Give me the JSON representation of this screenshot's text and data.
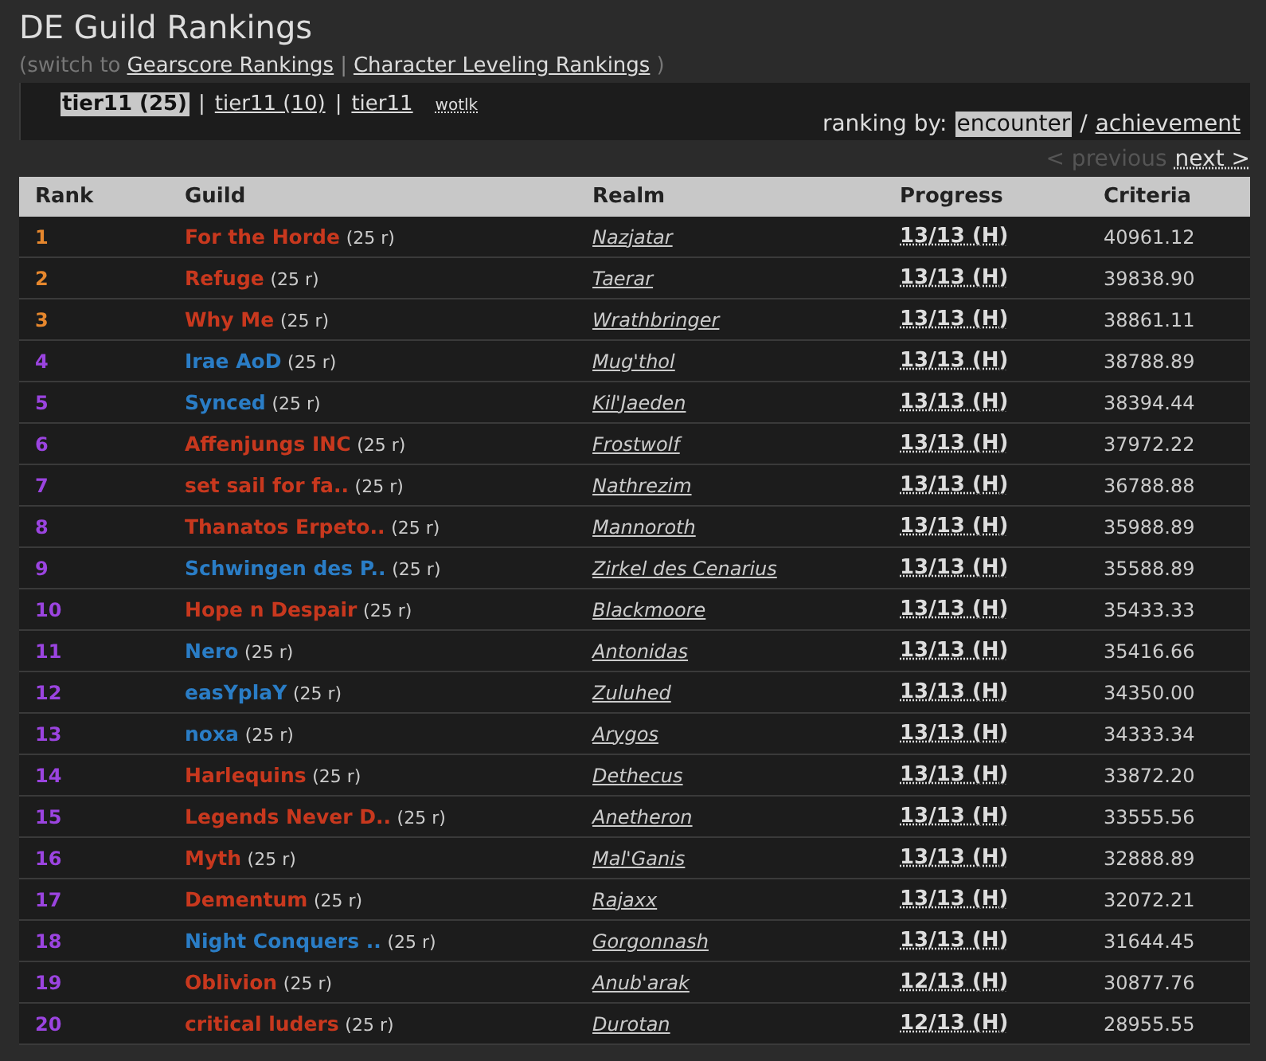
{
  "title": "DE Guild Rankings",
  "switch": {
    "prefix": "(switch to",
    "links": [
      "Gearscore Rankings",
      "Character Leveling Rankings"
    ],
    "separator": "|",
    "suffix": ")"
  },
  "tabs": [
    {
      "label": "tier11 (25)",
      "selected": true,
      "kind": "main"
    },
    {
      "label": "tier11 (10)",
      "selected": false,
      "kind": "main"
    },
    {
      "label": "tier11",
      "selected": false,
      "kind": "main"
    },
    {
      "label": "wotlk",
      "selected": false,
      "kind": "small"
    }
  ],
  "tab_separator": "|",
  "ranking_by": {
    "label": "ranking by:",
    "separator": "/",
    "options": [
      {
        "label": "encounter",
        "selected": true
      },
      {
        "label": "achievement",
        "selected": false
      }
    ]
  },
  "pager": {
    "previous": {
      "label": "< previous",
      "disabled": true
    },
    "next": {
      "label": "next >",
      "disabled": false
    }
  },
  "table": {
    "columns": [
      "Rank",
      "Guild",
      "Realm",
      "Progress",
      "Criteria"
    ],
    "rows": [
      {
        "rank": {
          "text": "1",
          "color": "#e6872d"
        },
        "guild": {
          "name": "For the Horde",
          "color": "#c8381e"
        },
        "size": "(25 r)",
        "realm": "Nazjatar",
        "progress": "13/13 (H)",
        "criteria": "40961.12"
      },
      {
        "rank": {
          "text": "2",
          "color": "#e6872d"
        },
        "guild": {
          "name": "Refuge",
          "color": "#c8381e"
        },
        "size": "(25 r)",
        "realm": "Taerar",
        "progress": "13/13 (H)",
        "criteria": "39838.90"
      },
      {
        "rank": {
          "text": "3",
          "color": "#e6872d"
        },
        "guild": {
          "name": "Why Me",
          "color": "#c8381e"
        },
        "size": "(25 r)",
        "realm": "Wrathbringer",
        "progress": "13/13 (H)",
        "criteria": "38861.11"
      },
      {
        "rank": {
          "text": "4",
          "color": "#9b44e0"
        },
        "guild": {
          "name": "Irae AoD",
          "color": "#2a7dc6"
        },
        "size": "(25 r)",
        "realm": "Mug'thol",
        "progress": "13/13 (H)",
        "criteria": "38788.89"
      },
      {
        "rank": {
          "text": "5",
          "color": "#9b44e0"
        },
        "guild": {
          "name": "Synced",
          "color": "#2a7dc6"
        },
        "size": "(25 r)",
        "realm": "Kil'Jaeden",
        "progress": "13/13 (H)",
        "criteria": "38394.44"
      },
      {
        "rank": {
          "text": "6",
          "color": "#9b44e0"
        },
        "guild": {
          "name": "Affenjungs INC",
          "color": "#c8381e"
        },
        "size": "(25 r)",
        "realm": "Frostwolf",
        "progress": "13/13 (H)",
        "criteria": "37972.22"
      },
      {
        "rank": {
          "text": "7",
          "color": "#9b44e0"
        },
        "guild": {
          "name": "set sail for fa..",
          "color": "#c8381e"
        },
        "size": "(25 r)",
        "realm": "Nathrezim",
        "progress": "13/13 (H)",
        "criteria": "36788.88"
      },
      {
        "rank": {
          "text": "8",
          "color": "#9b44e0"
        },
        "guild": {
          "name": "Thanatos Erpeto..",
          "color": "#c8381e"
        },
        "size": "(25 r)",
        "realm": "Mannoroth",
        "progress": "13/13 (H)",
        "criteria": "35988.89"
      },
      {
        "rank": {
          "text": "9",
          "color": "#9b44e0"
        },
        "guild": {
          "name": "Schwingen des P..",
          "color": "#2a7dc6"
        },
        "size": "(25 r)",
        "realm": "Zirkel des Cenarius",
        "progress": "13/13 (H)",
        "criteria": "35588.89"
      },
      {
        "rank": {
          "text": "10",
          "color": "#9b44e0"
        },
        "guild": {
          "name": "Hope n Despair",
          "color": "#c8381e"
        },
        "size": "(25 r)",
        "realm": "Blackmoore",
        "progress": "13/13 (H)",
        "criteria": "35433.33"
      },
      {
        "rank": {
          "text": "11",
          "color": "#9b44e0"
        },
        "guild": {
          "name": "Nero",
          "color": "#2a7dc6"
        },
        "size": "(25 r)",
        "realm": "Antonidas",
        "progress": "13/13 (H)",
        "criteria": "35416.66"
      },
      {
        "rank": {
          "text": "12",
          "color": "#9b44e0"
        },
        "guild": {
          "name": "easYplaY",
          "color": "#2a7dc6"
        },
        "size": "(25 r)",
        "realm": "Zuluhed",
        "progress": "13/13 (H)",
        "criteria": "34350.00"
      },
      {
        "rank": {
          "text": "13",
          "color": "#9b44e0"
        },
        "guild": {
          "name": "noxa",
          "color": "#2a7dc6"
        },
        "size": "(25 r)",
        "realm": "Arygos",
        "progress": "13/13 (H)",
        "criteria": "34333.34"
      },
      {
        "rank": {
          "text": "14",
          "color": "#9b44e0"
        },
        "guild": {
          "name": "Harlequins",
          "color": "#c8381e"
        },
        "size": "(25 r)",
        "realm": "Dethecus",
        "progress": "13/13 (H)",
        "criteria": "33872.20"
      },
      {
        "rank": {
          "text": "15",
          "color": "#9b44e0"
        },
        "guild": {
          "name": "Legends Never D..",
          "color": "#c8381e"
        },
        "size": "(25 r)",
        "realm": "Anetheron",
        "progress": "13/13 (H)",
        "criteria": "33555.56"
      },
      {
        "rank": {
          "text": "16",
          "color": "#9b44e0"
        },
        "guild": {
          "name": "Myth",
          "color": "#c8381e"
        },
        "size": "(25 r)",
        "realm": "Mal'Ganis",
        "progress": "13/13 (H)",
        "criteria": "32888.89"
      },
      {
        "rank": {
          "text": "17",
          "color": "#9b44e0"
        },
        "guild": {
          "name": "Dementum",
          "color": "#c8381e"
        },
        "size": "(25 r)",
        "realm": "Rajaxx",
        "progress": "13/13 (H)",
        "criteria": "32072.21"
      },
      {
        "rank": {
          "text": "18",
          "color": "#9b44e0"
        },
        "guild": {
          "name": "Night Conquers ..",
          "color": "#2a7dc6"
        },
        "size": "(25 r)",
        "realm": "Gorgonnash",
        "progress": "13/13 (H)",
        "criteria": "31644.45"
      },
      {
        "rank": {
          "text": "19",
          "color": "#9b44e0"
        },
        "guild": {
          "name": "Oblivion",
          "color": "#c8381e"
        },
        "size": "(25 r)",
        "realm": "Anub'arak",
        "progress": "12/13 (H)",
        "criteria": "30877.76"
      },
      {
        "rank": {
          "text": "20",
          "color": "#9b44e0"
        },
        "guild": {
          "name": "critical luders",
          "color": "#c8381e"
        },
        "size": "(25 r)",
        "realm": "Durotan",
        "progress": "12/13 (H)",
        "criteria": "28955.55"
      }
    ]
  }
}
